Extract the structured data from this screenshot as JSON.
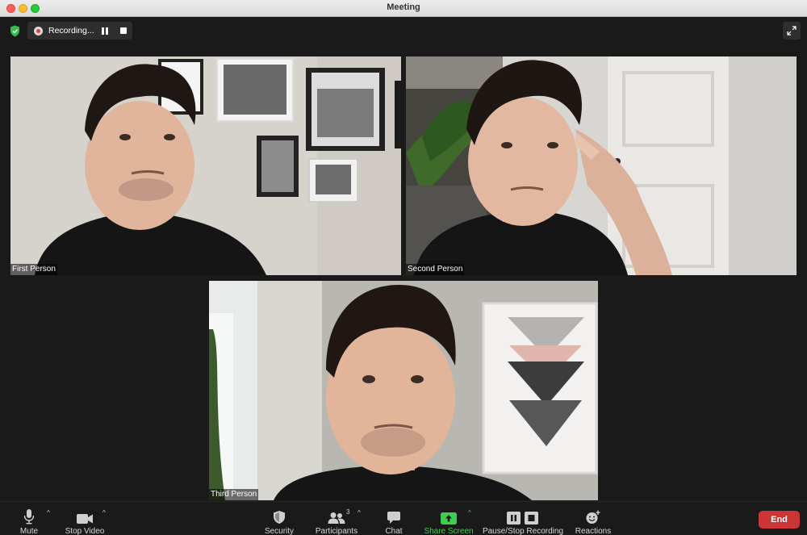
{
  "window": {
    "title": "Meeting"
  },
  "recording": {
    "label": "Recording..."
  },
  "participants": [
    {
      "name": "First Person"
    },
    {
      "name": "Second Person"
    },
    {
      "name": "Third Person"
    }
  ],
  "toolbar": {
    "mute": "Mute",
    "stop_video": "Stop Video",
    "security": "Security",
    "participants": "Participants",
    "participants_count": "3",
    "chat": "Chat",
    "share_screen": "Share Screen",
    "pause_stop_recording": "Pause/Stop Recording",
    "reactions": "Reactions",
    "end": "End"
  },
  "colors": {
    "background": "#1a1a1a",
    "end_button": "#cb3535",
    "share_green": "#3fcf4f",
    "security_shield": "#2fbf4a"
  },
  "icons": [
    "shield-icon",
    "record-icon",
    "pause-icon",
    "stop-icon",
    "fullscreen-icon",
    "microphone-icon",
    "video-camera-icon",
    "security-icon",
    "participants-icon",
    "chat-icon",
    "share-screen-icon",
    "pause-stop-recording-icon",
    "reactions-icon"
  ]
}
